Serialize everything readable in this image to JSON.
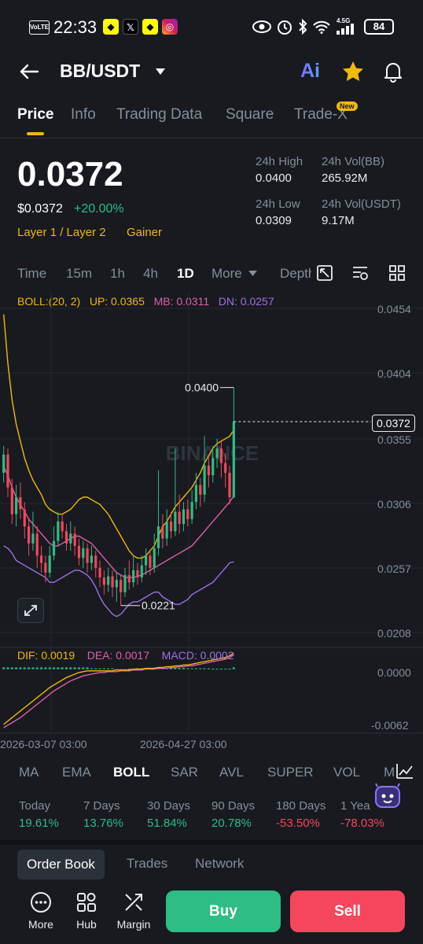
{
  "status_bar": {
    "time": "22:33",
    "volte": "VoLTE",
    "network": "4.5G",
    "battery": "84"
  },
  "header": {
    "pair": "BB/USDT",
    "ai_label": "Ai"
  },
  "tabs": [
    {
      "label": "Price"
    },
    {
      "label": "Info"
    },
    {
      "label": "Trading Data"
    },
    {
      "label": "Square"
    },
    {
      "label": "Trade-X",
      "badge": "New"
    }
  ],
  "price": {
    "last": "0.0372",
    "usd": "$0.0372",
    "change": "+20.00%",
    "tags": [
      "Layer 1 / Layer 2",
      "Gainer"
    ]
  },
  "stats": {
    "high_label": "24h High",
    "high": "0.0400",
    "low_label": "24h Low",
    "low": "0.0309",
    "vol_bb_label": "24h Vol(BB)",
    "vol_bb": "265.92M",
    "vol_usdt_label": "24h Vol(USDT)",
    "vol_usdt": "9.17M"
  },
  "timeframes": [
    "Time",
    "15m",
    "1h",
    "4h",
    "1D",
    "More",
    "Depth"
  ],
  "boll_legend": {
    "name": "BOLL:(20, 2)",
    "up": "UP: 0.0365",
    "mb": "MB: 0.0311",
    "dn": "DN: 0.0257"
  },
  "macd_legend": {
    "dif": "DIF: 0.0019",
    "dea": "DEA: 0.0017",
    "macd": "MACD: 0.0002"
  },
  "price_axis": [
    "0.0454",
    "0.0404",
    "0.0355",
    "0.0306",
    "0.0257",
    "0.0208"
  ],
  "current_price_tag": "0.0372",
  "macd_axis": [
    "0.0000",
    "-0.0062"
  ],
  "annotations": {
    "high": "0.0400",
    "low": "0.0221"
  },
  "watermark": "BINANCE",
  "dates": [
    "2026-03-07 03:00",
    "2026-04-27 03:00"
  ],
  "indicators": [
    "MA",
    "EMA",
    "BOLL",
    "SAR",
    "AVL",
    "SUPER",
    "VOL",
    "M"
  ],
  "performance": [
    {
      "label": "Today",
      "value": "19.61%"
    },
    {
      "label": "7 Days",
      "value": "13.76%"
    },
    {
      "label": "30 Days",
      "value": "51.84%"
    },
    {
      "label": "90 Days",
      "value": "20.78%"
    },
    {
      "label": "180 Days",
      "value": "-53.50%"
    },
    {
      "label": "1 Year",
      "value": "-78.03%"
    }
  ],
  "bottom_tabs": [
    "Order Book",
    "Trades",
    "Network"
  ],
  "nav": {
    "more": "More",
    "hub": "Hub",
    "margin": "Margin",
    "buy": "Buy",
    "sell": "Sell"
  },
  "colors": {
    "up": "#2ebd85",
    "down": "#f6465d",
    "accent": "#f0b90b",
    "boll_up": "#f0b90b",
    "boll_mb": "#e05fa8",
    "boll_dn": "#a070e0"
  },
  "chart_data": {
    "type": "candlestick",
    "price_range": [
      0.0195,
      0.0465
    ],
    "current": 0.0372,
    "period_high": 0.04,
    "period_low": 0.0221,
    "candles": [
      [
        0.033,
        0.0345,
        0.0352,
        0.0322
      ],
      [
        0.0345,
        0.0318,
        0.035,
        0.031
      ],
      [
        0.0318,
        0.0296,
        0.0325,
        0.0288
      ],
      [
        0.0296,
        0.031,
        0.032,
        0.0286
      ],
      [
        0.031,
        0.03,
        0.0322,
        0.0292
      ],
      [
        0.03,
        0.0286,
        0.0306,
        0.0276
      ],
      [
        0.0286,
        0.0272,
        0.0292,
        0.0262
      ],
      [
        0.0272,
        0.028,
        0.0298,
        0.0266
      ],
      [
        0.028,
        0.0262,
        0.0286,
        0.0252
      ],
      [
        0.0262,
        0.0256,
        0.027,
        0.0248
      ],
      [
        0.0256,
        0.0248,
        0.0262,
        0.024
      ],
      [
        0.0248,
        0.0262,
        0.027,
        0.0244
      ],
      [
        0.0262,
        0.0274,
        0.0286,
        0.0258
      ],
      [
        0.0274,
        0.029,
        0.0298,
        0.027
      ],
      [
        0.029,
        0.0282,
        0.0296,
        0.0276
      ],
      [
        0.0282,
        0.0272,
        0.0288,
        0.0266
      ],
      [
        0.0272,
        0.028,
        0.029,
        0.0266
      ],
      [
        0.028,
        0.027,
        0.0286,
        0.0262
      ],
      [
        0.027,
        0.026,
        0.0276,
        0.0254
      ],
      [
        0.026,
        0.0268,
        0.0274,
        0.0252
      ],
      [
        0.0268,
        0.0256,
        0.0272,
        0.0248
      ],
      [
        0.0256,
        0.0262,
        0.027,
        0.025
      ],
      [
        0.0262,
        0.0252,
        0.0266,
        0.0244
      ],
      [
        0.0252,
        0.0244,
        0.0258,
        0.0236
      ],
      [
        0.0244,
        0.0238,
        0.025,
        0.023
      ],
      [
        0.0238,
        0.0245,
        0.0252,
        0.0232
      ],
      [
        0.0245,
        0.0236,
        0.025,
        0.0228
      ],
      [
        0.0236,
        0.0242,
        0.0248,
        0.0224
      ],
      [
        0.0242,
        0.0232,
        0.0246,
        0.0221
      ],
      [
        0.0232,
        0.0246,
        0.0252,
        0.0228
      ],
      [
        0.0246,
        0.024,
        0.0258,
        0.0234
      ],
      [
        0.024,
        0.025,
        0.0262,
        0.0236
      ],
      [
        0.025,
        0.0244,
        0.0256,
        0.0238
      ],
      [
        0.0244,
        0.0254,
        0.0262,
        0.024
      ],
      [
        0.0254,
        0.0262,
        0.0268,
        0.0246
      ],
      [
        0.0262,
        0.0252,
        0.0266,
        0.0246
      ],
      [
        0.0252,
        0.0268,
        0.028,
        0.0248
      ],
      [
        0.0268,
        0.0286,
        0.0332,
        0.0262
      ],
      [
        0.0286,
        0.0276,
        0.0296,
        0.0268
      ],
      [
        0.0276,
        0.029,
        0.03,
        0.027
      ],
      [
        0.029,
        0.0282,
        0.0298,
        0.0276
      ],
      [
        0.0282,
        0.0298,
        0.035,
        0.0278
      ],
      [
        0.0298,
        0.0288,
        0.0312,
        0.028
      ],
      [
        0.0288,
        0.03,
        0.0306,
        0.0282
      ],
      [
        0.03,
        0.0292,
        0.0308,
        0.0286
      ],
      [
        0.0292,
        0.0306,
        0.0316,
        0.0288
      ],
      [
        0.0306,
        0.032,
        0.033,
        0.03
      ],
      [
        0.032,
        0.0312,
        0.0326,
        0.0302
      ],
      [
        0.0312,
        0.0336,
        0.036,
        0.0306
      ],
      [
        0.0336,
        0.0328,
        0.0344,
        0.0318
      ],
      [
        0.0328,
        0.0342,
        0.0352,
        0.0322
      ],
      [
        0.0342,
        0.035,
        0.0358,
        0.0334
      ],
      [
        0.035,
        0.0338,
        0.0356,
        0.0326
      ],
      [
        0.0338,
        0.033,
        0.0346,
        0.0318
      ],
      [
        0.033,
        0.031,
        0.0336,
        0.0304
      ],
      [
        0.031,
        0.0372,
        0.04,
        0.0309
      ]
    ],
    "boll_up": [
      0.046,
      0.042,
      0.039,
      0.037,
      0.0356,
      0.0342,
      0.0332,
      0.0324,
      0.0318,
      0.0312,
      0.0304,
      0.03,
      0.0298,
      0.0296,
      0.0296,
      0.0298,
      0.03,
      0.0304,
      0.0308,
      0.031,
      0.031,
      0.0308,
      0.0306,
      0.0304,
      0.03,
      0.0296,
      0.029,
      0.0284,
      0.0278,
      0.0272,
      0.0266,
      0.0262,
      0.026,
      0.026,
      0.0262,
      0.0266,
      0.027,
      0.0278,
      0.0286,
      0.029,
      0.0296,
      0.0302,
      0.0306,
      0.031,
      0.0314,
      0.0318,
      0.0324,
      0.033,
      0.0338,
      0.0344,
      0.035,
      0.0354,
      0.0356,
      0.0358,
      0.036,
      0.0365
    ],
    "boll_mb": [
      0.0335,
      0.0328,
      0.0318,
      0.031,
      0.0304,
      0.0298,
      0.0292,
      0.0288,
      0.0284,
      0.028,
      0.0276,
      0.0272,
      0.027,
      0.027,
      0.0272,
      0.0274,
      0.0276,
      0.0278,
      0.0278,
      0.0276,
      0.0274,
      0.0272,
      0.0268,
      0.0264,
      0.026,
      0.0256,
      0.0252,
      0.0248,
      0.0246,
      0.0244,
      0.0244,
      0.0244,
      0.0245,
      0.0246,
      0.0248,
      0.025,
      0.0252,
      0.0254,
      0.0256,
      0.0258,
      0.026,
      0.0262,
      0.0264,
      0.0266,
      0.0268,
      0.027,
      0.0274,
      0.0278,
      0.0282,
      0.0286,
      0.029,
      0.0294,
      0.0298,
      0.0302,
      0.0306,
      0.0311
    ],
    "boll_dn": [
      0.027,
      0.0268,
      0.0264,
      0.0258,
      0.0256,
      0.0254,
      0.0252,
      0.025,
      0.0248,
      0.0246,
      0.0244,
      0.024,
      0.024,
      0.0242,
      0.0244,
      0.0246,
      0.0248,
      0.025,
      0.025,
      0.0248,
      0.0246,
      0.0242,
      0.0236,
      0.0228,
      0.0222,
      0.0218,
      0.0214,
      0.0212,
      0.0214,
      0.0218,
      0.0222,
      0.0224,
      0.0224,
      0.0226,
      0.0228,
      0.023,
      0.0232,
      0.0232,
      0.0228,
      0.0226,
      0.0224,
      0.0222,
      0.0222,
      0.0224,
      0.0226,
      0.023,
      0.0232,
      0.0234,
      0.0236,
      0.0238,
      0.024,
      0.0244,
      0.0248,
      0.0252,
      0.0256,
      0.0257
    ],
    "macd_range": [
      -0.007,
      0.001
    ],
    "dif": [
      -0.0066,
      -0.0062,
      -0.0058,
      -0.0054,
      -0.005,
      -0.0046,
      -0.0042,
      -0.0038,
      -0.0034,
      -0.003,
      -0.0026,
      -0.0022,
      -0.0019,
      -0.0016,
      -0.0013,
      -0.001,
      -0.0008,
      -0.0006,
      -0.0004,
      -0.0003,
      -0.0002,
      -0.0002,
      -0.0002,
      -0.0002,
      -0.0002,
      -0.0002,
      -0.0002,
      -0.0001,
      -0.0001,
      -0.0001,
      -0.0001,
      -0.0,
      0.0,
      0.0,
      0.0001,
      0.0001,
      0.0001,
      0.0002,
      0.0002,
      0.0003,
      0.0003,
      0.0004,
      0.0004,
      0.0005,
      0.0005,
      0.0006,
      0.0007,
      0.0008,
      0.0009,
      0.001,
      0.0011,
      0.0012,
      0.0013,
      0.0014,
      0.0016,
      0.0019
    ],
    "dea": [
      -0.007,
      -0.0067,
      -0.0064,
      -0.0061,
      -0.0058,
      -0.0054,
      -0.005,
      -0.0046,
      -0.0042,
      -0.0038,
      -0.0034,
      -0.003,
      -0.0026,
      -0.0023,
      -0.002,
      -0.0017,
      -0.0014,
      -0.0012,
      -0.001,
      -0.0008,
      -0.0007,
      -0.0006,
      -0.0005,
      -0.0004,
      -0.0004,
      -0.0003,
      -0.0003,
      -0.0003,
      -0.0002,
      -0.0002,
      -0.0002,
      -0.0001,
      -0.0001,
      -0.0001,
      0.0,
      0.0,
      0.0,
      0.0001,
      0.0001,
      0.0001,
      0.0002,
      0.0002,
      0.0003,
      0.0003,
      0.0004,
      0.0004,
      0.0005,
      0.0006,
      0.0007,
      0.0008,
      0.0009,
      0.001,
      0.0011,
      0.0012,
      0.0014,
      0.0017
    ],
    "histogram": [
      0.0002,
      0.0002,
      0.0002,
      0.0002,
      0.0002,
      0.0002,
      0.0002,
      0.0002,
      0.0002,
      0.0002,
      0.0002,
      0.0002,
      0.0002,
      0.0002,
      0.0002,
      0.0002,
      0.0002,
      0.0002,
      0.0002,
      0.0002,
      0.0002,
      0.0001,
      0.0001,
      0.0001,
      0.0001,
      0.0001,
      0.0001,
      -5e-05,
      -5e-05,
      -5e-05,
      5e-05,
      5e-05,
      0.0001,
      0.0001,
      0.0001,
      0.0001,
      0.0001,
      0.0001,
      0.0001,
      0.0001,
      0.00015,
      0.00015,
      0.00015,
      0.00015,
      0.0001,
      0.0001,
      0.0001,
      0.0001,
      0.0001,
      0.0001,
      5e-05,
      5e-05,
      5e-05,
      5e-05,
      5e-05,
      0.0002
    ]
  }
}
